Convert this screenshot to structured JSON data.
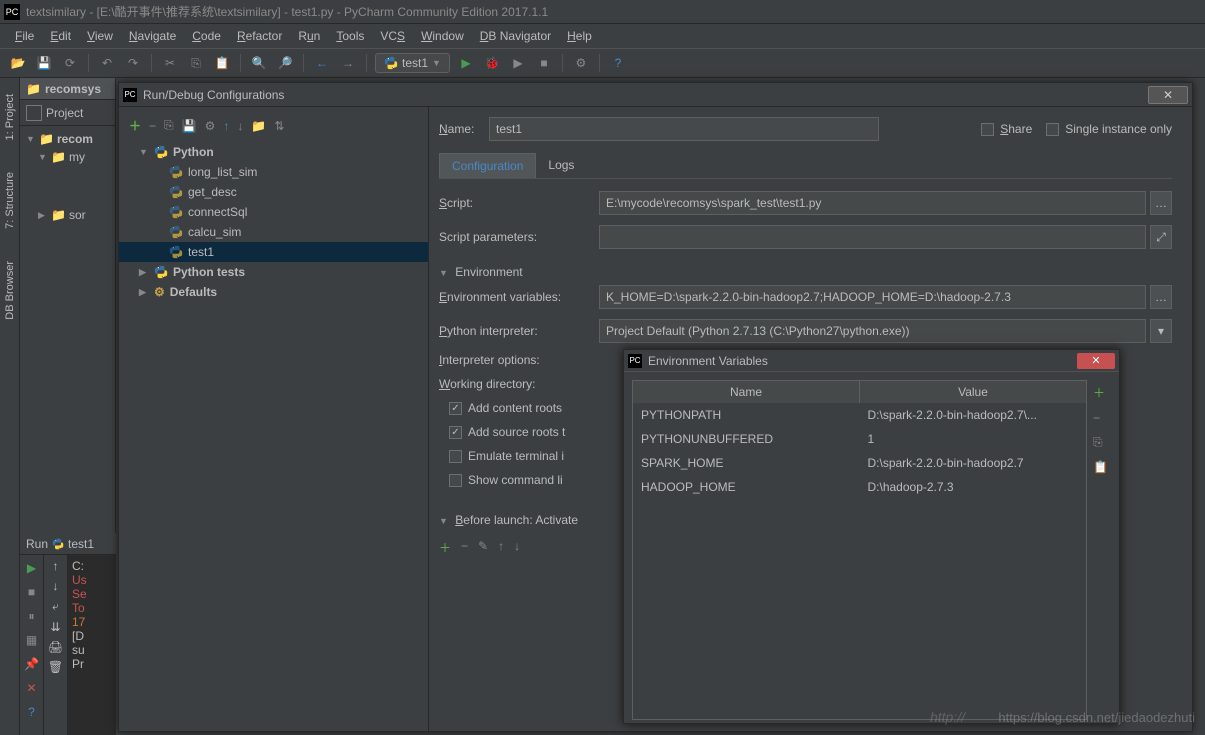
{
  "titlebar": {
    "text": "textsimilary - [E:\\酷开事件\\推荐系统\\textsimilary] - test1.py - PyCharm Community Edition 2017.1.1"
  },
  "menubar": [
    "File",
    "Edit",
    "View",
    "Navigate",
    "Code",
    "Refactor",
    "Run",
    "Tools",
    "VCS",
    "Window",
    "DB Navigator",
    "Help"
  ],
  "toolbar": {
    "run_config": "test1"
  },
  "project_panel": {
    "title": "recomsys",
    "tab": "Project",
    "tree": [
      {
        "label": "recom",
        "level": 0,
        "arrow": "▼"
      },
      {
        "label": "my",
        "level": 1,
        "arrow": "▼"
      },
      {
        "label": "sor",
        "level": 1,
        "arrow": "▶"
      }
    ]
  },
  "sidebar": {
    "items": [
      "1: Project",
      "7: Structure",
      "DB Browser"
    ]
  },
  "dialog": {
    "title": "Run/Debug Configurations",
    "tree": [
      {
        "label": "Python",
        "type": "group",
        "arrow": "▼"
      },
      {
        "label": "long_list_sim",
        "type": "item"
      },
      {
        "label": "get_desc",
        "type": "item"
      },
      {
        "label": "connectSql",
        "type": "item"
      },
      {
        "label": "calcu_sim",
        "type": "item"
      },
      {
        "label": "test1",
        "type": "item",
        "selected": true
      },
      {
        "label": "Python tests",
        "type": "group",
        "arrow": "▶"
      },
      {
        "label": "Defaults",
        "type": "defaults",
        "arrow": "▶"
      }
    ],
    "form": {
      "name_label": "Name:",
      "name_value": "test1",
      "share_label": "Share",
      "single_instance_label": "Single instance only",
      "tabs": [
        "Configuration",
        "Logs"
      ],
      "script_label": "Script:",
      "script_value": "E:\\mycode\\recomsys\\spark_test\\test1.py",
      "script_params_label": "Script parameters:",
      "script_params_value": "",
      "env_section": "Environment",
      "env_vars_label": "Environment variables:",
      "env_vars_value": "K_HOME=D:\\spark-2.2.0-bin-hadoop2.7;HADOOP_HOME=D:\\hadoop-2.7.3",
      "interpreter_label": "Python interpreter:",
      "interpreter_value": "Project Default (Python 2.7.13 (C:\\Python27\\python.exe))",
      "interp_opts_label": "Interpreter options:",
      "workdir_label": "Working directory:",
      "add_content_label": "Add content roots",
      "add_source_label": "Add source roots t",
      "emulate_label": "Emulate terminal i",
      "show_cmd_label": "Show command li",
      "before_launch_label": "Before launch: Activate"
    }
  },
  "env_dialog": {
    "title": "Environment Variables",
    "columns": [
      "Name",
      "Value"
    ],
    "rows": [
      {
        "name": "PYTHONPATH",
        "value": "D:\\spark-2.2.0-bin-hadoop2.7\\..."
      },
      {
        "name": "PYTHONUNBUFFERED",
        "value": "1"
      },
      {
        "name": "SPARK_HOME",
        "value": "D:\\spark-2.2.0-bin-hadoop2.7"
      },
      {
        "name": "HADOOP_HOME",
        "value": "D:\\hadoop-2.7.3"
      }
    ]
  },
  "run_panel": {
    "title": "Run",
    "config": "test1",
    "lines": [
      {
        "t": "C:",
        "c": ""
      },
      {
        "t": "Us",
        "c": "err"
      },
      {
        "t": "Se",
        "c": "err"
      },
      {
        "t": "To",
        "c": "err"
      },
      {
        "t": "17",
        "c": "red"
      },
      {
        "t": "[D",
        "c": ""
      },
      {
        "t": "su",
        "c": ""
      },
      {
        "t": "",
        "c": ""
      },
      {
        "t": "Pr",
        "c": ""
      }
    ]
  },
  "watermark": "https://blog.csdn.net/jiedaodezhuti",
  "watermark2": "http://"
}
